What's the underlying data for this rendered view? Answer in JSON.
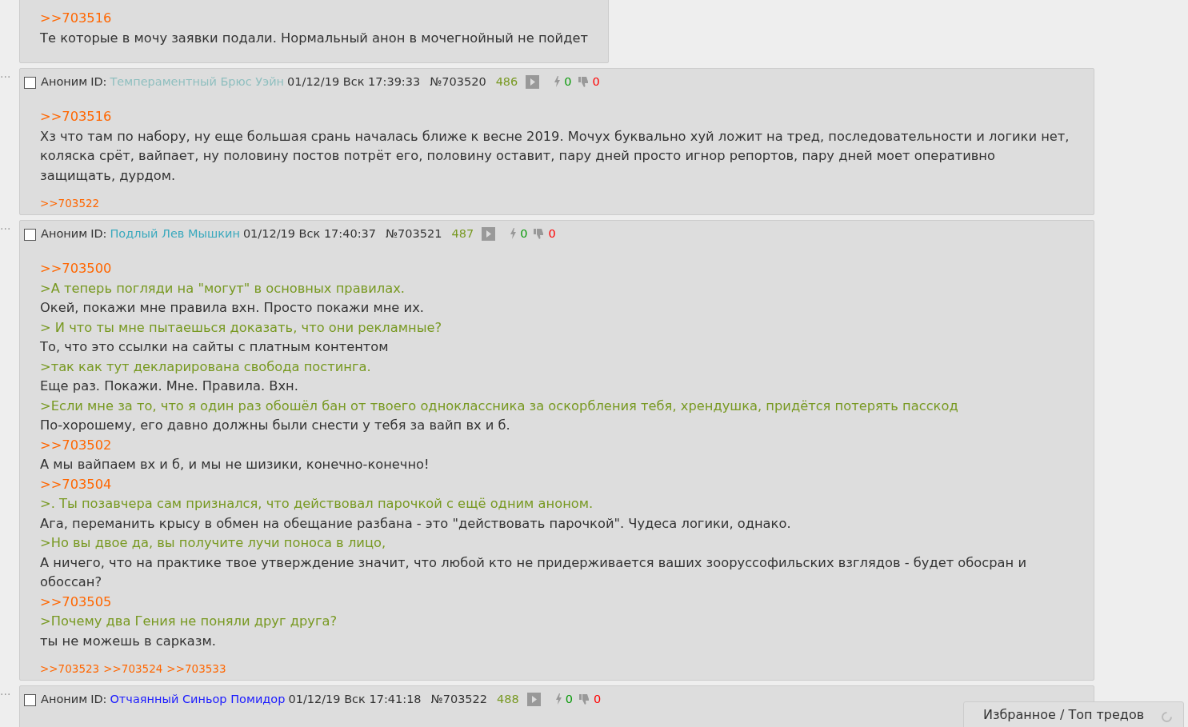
{
  "posts": [
    {
      "lines": [
        {
          "kind": "reply",
          "text": ">>703516"
        },
        {
          "kind": "text",
          "text": "Те которые в мочу заявки подали. Нормальный анон в мочегнойный не пойдет"
        }
      ]
    },
    {
      "header": {
        "checked": false,
        "author": "Аноним",
        "id_label": "ID:",
        "name": "Темпераментный Брюс Уэйн",
        "color": "#8fbfbf",
        "date": "01/12/19 Вск 17:39:33",
        "number": "№703520",
        "count": "486",
        "likes": "0",
        "dislikes": "0"
      },
      "menu": "···",
      "lines": [
        {
          "kind": "reply",
          "text": ">>703516"
        },
        {
          "kind": "text",
          "text": "Хз что там по набору, ну еще большая срань началась ближе к весне 2019. Мочух буквально хуй ложит на тред, последовательности и логики нет, коляска срёт, вайпает, ну половину постов потрёт его, половину оставит, пару дней просто игнор репортов, пару дней моет оперативно защищать, дурдом."
        }
      ],
      "backlinks": [
        ">>703522"
      ]
    },
    {
      "header": {
        "checked": false,
        "author": "Аноним",
        "id_label": "ID:",
        "name": "Подлый Лев Мышкин",
        "color": "#3aa9bd",
        "date": "01/12/19 Вск 17:40:37",
        "number": "№703521",
        "count": "487",
        "likes": "0",
        "dislikes": "0"
      },
      "menu": "···",
      "lines": [
        {
          "kind": "reply",
          "text": ">>703500"
        },
        {
          "kind": "quote",
          "text": ">А теперь погляди на \"могут\" в основных правилах."
        },
        {
          "kind": "text",
          "text": "Окей, покажи мне правила вхн. Просто покажи мне их."
        },
        {
          "kind": "quote",
          "text": "> И что ты мне пытаешься доказать, что они рекламные?"
        },
        {
          "kind": "text",
          "text": "То, что это ссылки на сайты с платным контентом"
        },
        {
          "kind": "quote",
          "text": ">так как тут декларирована свобода постинга."
        },
        {
          "kind": "text",
          "text": "Еще раз. Покажи. Мне. Правила. Вхн."
        },
        {
          "kind": "quote",
          "text": ">Если мне за то, что я один раз обошёл бан от твоего одноклассника за оскорбления тебя, хрендушка, придётся потерять пасскод"
        },
        {
          "kind": "text",
          "text": "По-хорошему, его давно должны были снести у тебя за вайп вх и б."
        },
        {
          "kind": "reply",
          "text": ">>703502"
        },
        {
          "kind": "text",
          "text": "А мы вайпаем вх и б, и мы не шизики, конечно-конечно!"
        },
        {
          "kind": "reply",
          "text": ">>703504"
        },
        {
          "kind": "quote",
          "text": ">. Ты позавчера сам признался, что действовал парочкой с ещё одним аноном."
        },
        {
          "kind": "text",
          "text": "Ага, переманить крысу в обмен на обещание разбана - это \"действовать парочкой\". Чудеса логики, однако."
        },
        {
          "kind": "quote",
          "text": ">Но вы двое да, вы получите лучи поноса в лицо,"
        },
        {
          "kind": "text",
          "text": "А ничего, что на практике твое утверждение значит, что любой кто не придерживается ваших зооруссофильских взглядов - будет обосран и обоссан?"
        },
        {
          "kind": "reply",
          "text": ">>703505"
        },
        {
          "kind": "quote",
          "text": ">Почему два Гения не поняли друг друга?"
        },
        {
          "kind": "text",
          "text": "ты не можешь в сарказм."
        }
      ],
      "backlinks": [
        ">>703523",
        ">>703524",
        ">>703533"
      ]
    },
    {
      "header": {
        "checked": false,
        "author": "Аноним",
        "id_label": "ID:",
        "name": "Отчаянный Синьор Помидор",
        "color": "#1a1aff",
        "date": "01/12/19 Вск 17:41:18",
        "number": "№703522",
        "count": "488",
        "likes": "0",
        "dislikes": "0"
      },
      "menu": "···"
    }
  ],
  "favorites": {
    "label": "Избранное / Топ тредов"
  }
}
